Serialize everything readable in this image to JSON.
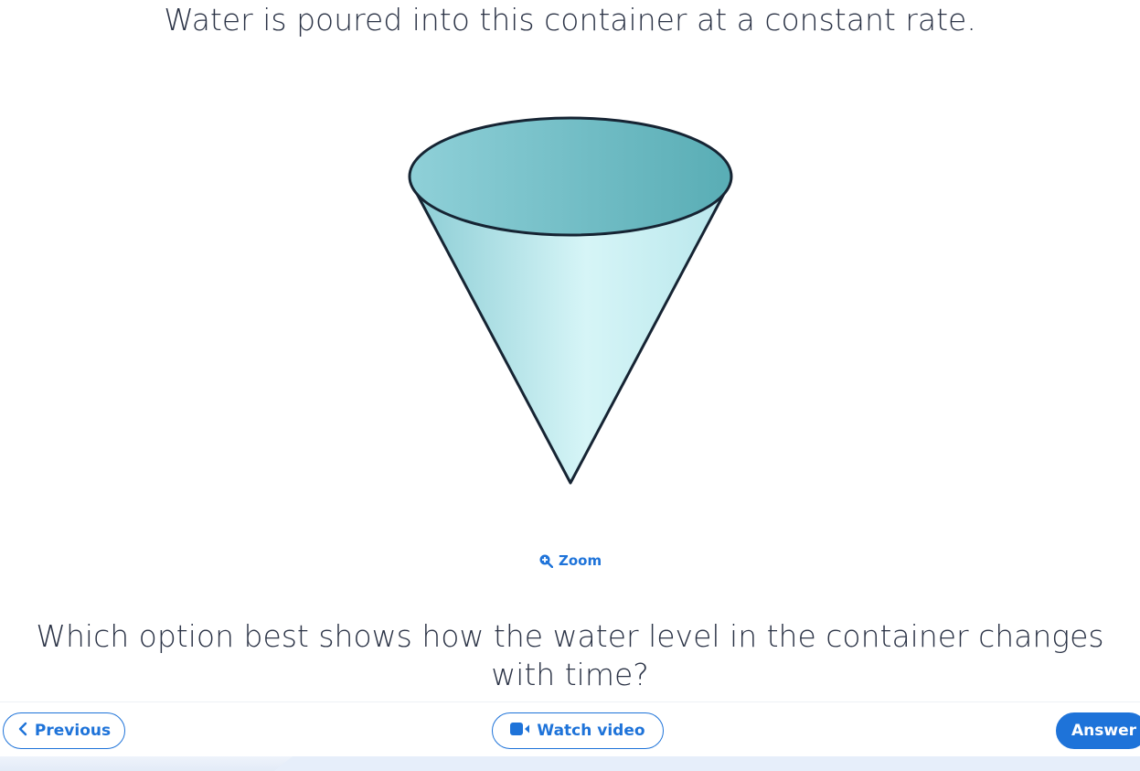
{
  "question": {
    "text": "Water is poured into this container at a constant rate."
  },
  "figure": {
    "fill_top_light": "#8fd0d8",
    "fill_top_dark": "#59adb5",
    "fill_body_light": "#d6f5f7",
    "fill_body_dark": "#8ccdd5",
    "stroke": "#162433"
  },
  "zoom": {
    "label": "Zoom",
    "icon": "zoom-in-icon"
  },
  "prompt": {
    "text": "Which option best shows how the water level in the container changes with time?"
  },
  "toolbar": {
    "previous_label": "Previous",
    "previous_icon": "chevron-left-icon",
    "video_label": "Watch video",
    "video_icon": "video-camera-icon",
    "answer_label": "Answer"
  },
  "colors": {
    "accent": "#1e73d9",
    "text": "#2b3346"
  }
}
